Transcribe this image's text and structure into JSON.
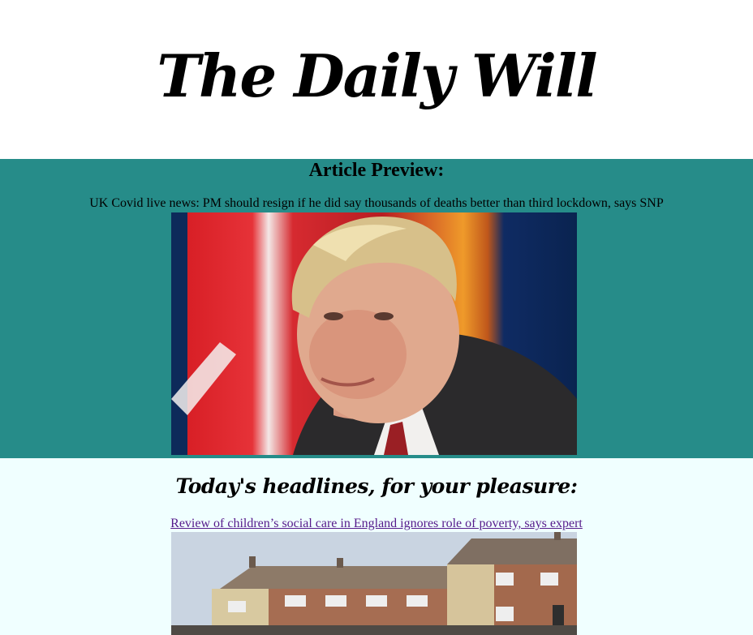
{
  "masthead": {
    "title": "The Daily Will"
  },
  "preview": {
    "heading": "Article Preview:",
    "headline": "UK Covid live news: PM should resign if he did say thousands of deaths better than third lockdown, says SNP"
  },
  "headlines": {
    "heading": "Today's headlines, for your pleasure:",
    "items": [
      {
        "title": "Review of children’s social care in England ignores role of poverty, says expert"
      }
    ]
  },
  "colors": {
    "preview_bg": "#268c89",
    "headlines_bg": "#f0ffff",
    "visited_link": "#551a8b"
  }
}
